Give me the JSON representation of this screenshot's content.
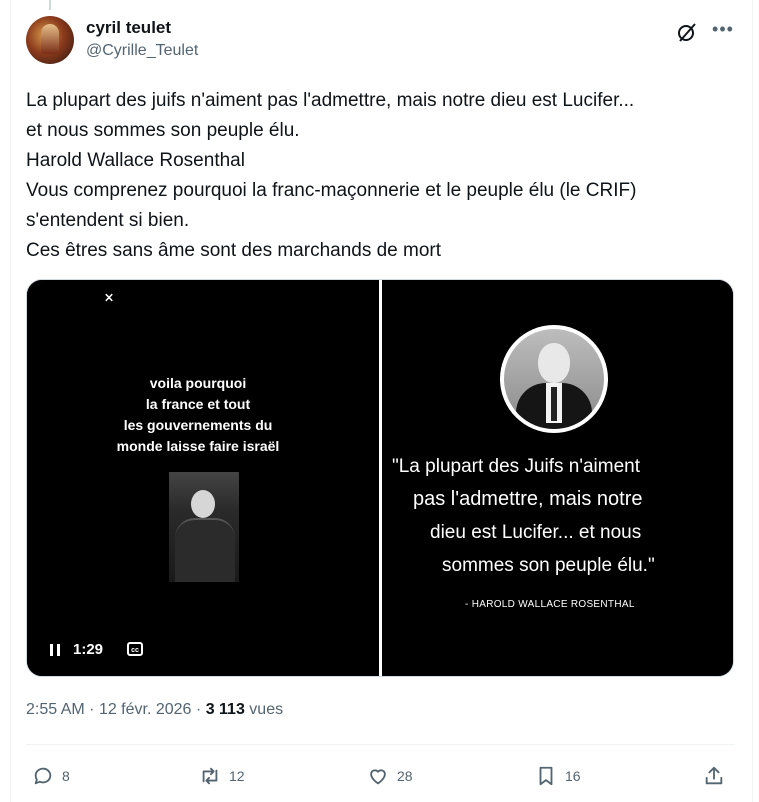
{
  "author": {
    "display_name": "cyril teulet",
    "handle": "@Cyrille_Teulet"
  },
  "tweet": {
    "lines": [
      "La plupart des juifs n'aiment pas l'admettre, mais notre dieu est Lucifer...",
      "et nous sommes son peuple élu.",
      "Harold Wallace Rosenthal",
      "Vous comprenez pourquoi la franc-maçonnerie et le peuple élu (le CRIF)",
      "s'entendent si bien.",
      "Ces êtres sans âme sont des marchands de mort"
    ]
  },
  "media": {
    "video": {
      "caption_lines": [
        "voila pourquoi",
        "la france et tout",
        "les gouvernements du",
        "monde laisse faire israël"
      ],
      "time": "1:29"
    },
    "image": {
      "quote_lines": [
        "\"La plupart des Juifs n'aiment",
        "pas l'admettre, mais notre",
        "dieu est Lucifer... et nous",
        "sommes son peuple élu.\""
      ],
      "attribution": "- HAROLD WALLACE ROSENTHAL"
    }
  },
  "meta": {
    "time": "2:55 AM",
    "date": "12 févr. 2026",
    "separator": "·",
    "views_count": "3 113",
    "views_label": "vues"
  },
  "actions": {
    "replies": "8",
    "reposts": "12",
    "likes": "28",
    "bookmarks": "16"
  },
  "icons": [
    "grok-icon",
    "more-icon",
    "pause-icon",
    "closed-captions-icon",
    "reply-icon",
    "repost-icon",
    "like-icon",
    "bookmark-icon",
    "share-icon"
  ]
}
